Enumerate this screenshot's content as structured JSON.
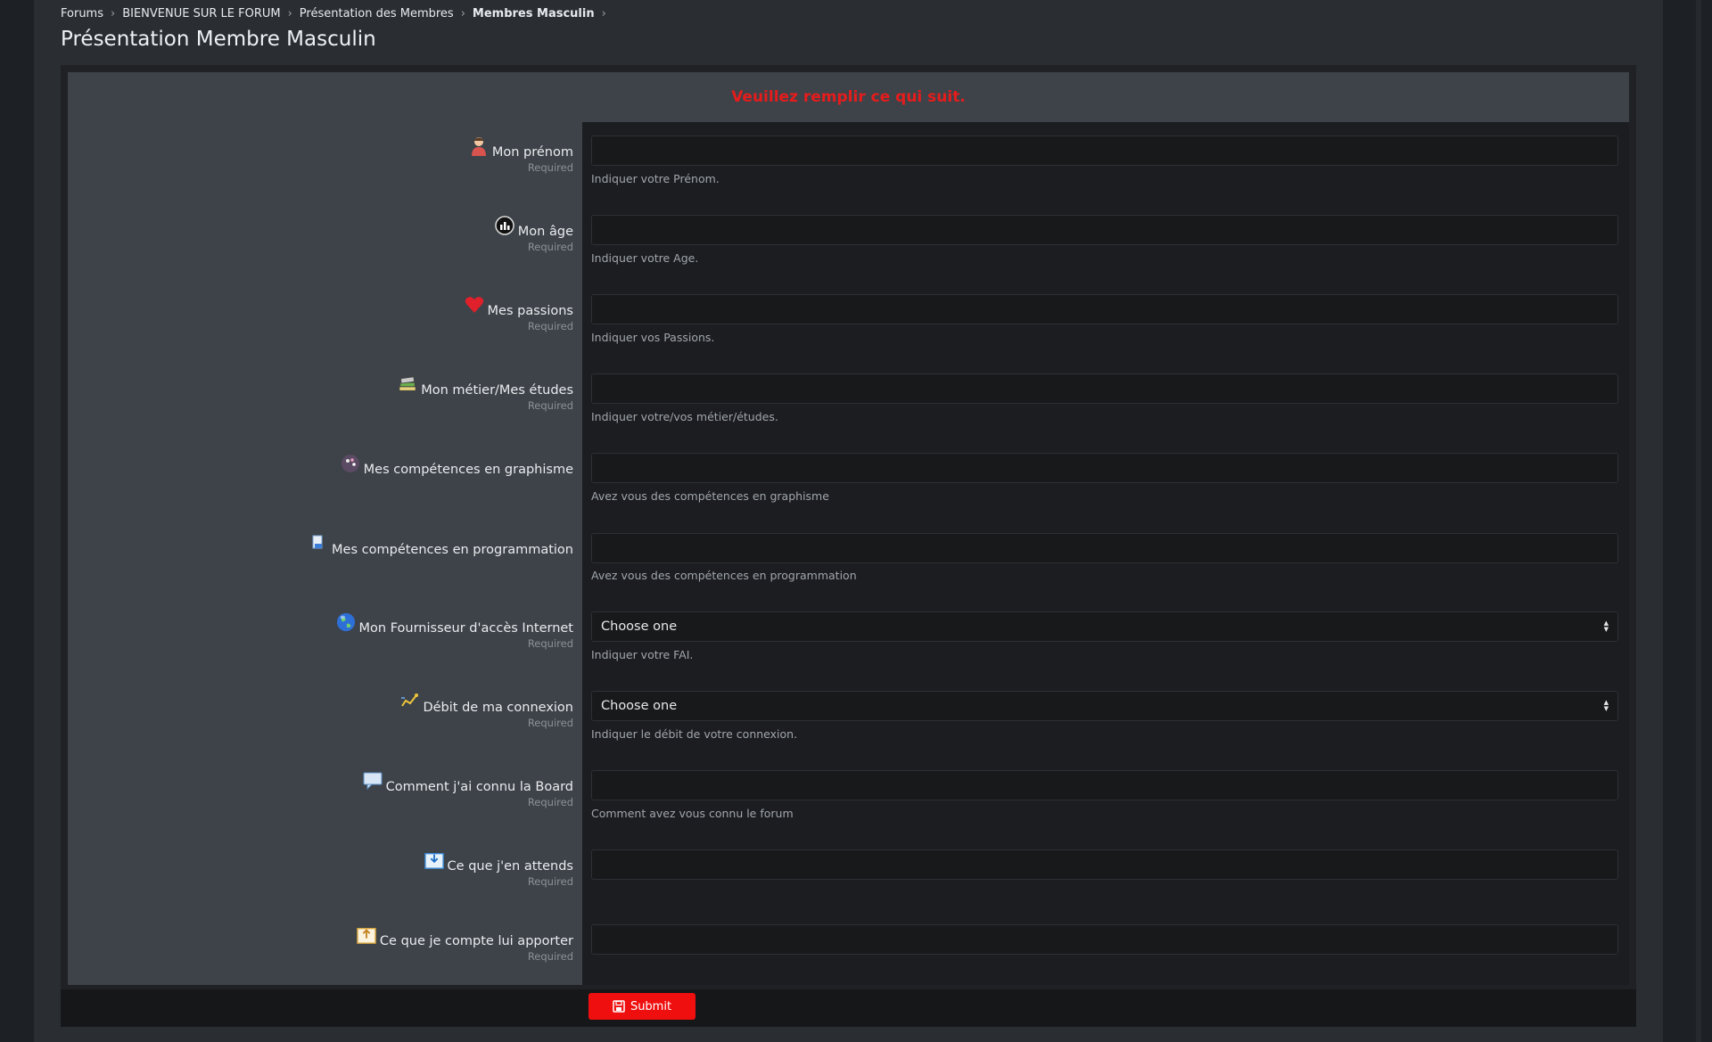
{
  "breadcrumb": {
    "items": [
      "Forums",
      "BIENVENUE SUR LE FORUM",
      "Présentation des Membres",
      "Membres Masculin"
    ],
    "separator": "›"
  },
  "page_title": "Présentation Membre Masculin",
  "form": {
    "header": "Veuillez remplir ce qui suit.",
    "required_label": "Required",
    "fields": [
      {
        "icon": "person-icon",
        "label": "Mon prénom",
        "required": true,
        "type": "text",
        "hint": "Indiquer votre Prénom."
      },
      {
        "icon": "age-chart-icon",
        "label": "Mon âge",
        "required": true,
        "type": "text",
        "hint": "Indiquer votre Age."
      },
      {
        "icon": "heart-icon",
        "label": "Mes passions",
        "required": true,
        "type": "text",
        "hint": "Indiquer vos Passions."
      },
      {
        "icon": "books-icon",
        "label": "Mon métier/Mes études",
        "required": true,
        "type": "text",
        "hint": "Indiquer votre/vos métier/études."
      },
      {
        "icon": "palette-icon",
        "label": "Mes compétences en graphisme",
        "required": false,
        "type": "text",
        "hint": "Avez vous des compétences en graphisme"
      },
      {
        "icon": "code-file-icon",
        "label": "Mes compétences en programmation",
        "required": false,
        "type": "text",
        "hint": "Avez vous des compétences en programmation"
      },
      {
        "icon": "globe-icon",
        "label": "Mon Fournisseur d'accès Internet",
        "required": true,
        "type": "select",
        "value": "Choose one",
        "hint": "Indiquer votre FAI."
      },
      {
        "icon": "speed-icon",
        "label": "Débit de ma connexion",
        "required": true,
        "type": "select",
        "value": "Choose one",
        "hint": "Indiquer le débit de votre connexion."
      },
      {
        "icon": "speech-bubble-icon",
        "label": "Comment j'ai connu la Board",
        "required": true,
        "type": "text",
        "hint": "Comment avez vous connu le forum"
      },
      {
        "icon": "inbox-download-icon",
        "label": "Ce que j'en attends",
        "required": true,
        "type": "text",
        "hint": ""
      },
      {
        "icon": "inbox-upload-icon",
        "label": "Ce que je compte lui apporter",
        "required": true,
        "type": "text",
        "hint": ""
      }
    ],
    "submit_label": "Submit"
  },
  "colors": {
    "header_text": "#e61c1c",
    "submit_bg": "#ef0f0f",
    "label_panel": "#3d4349",
    "input_panel": "#1b1d20"
  }
}
